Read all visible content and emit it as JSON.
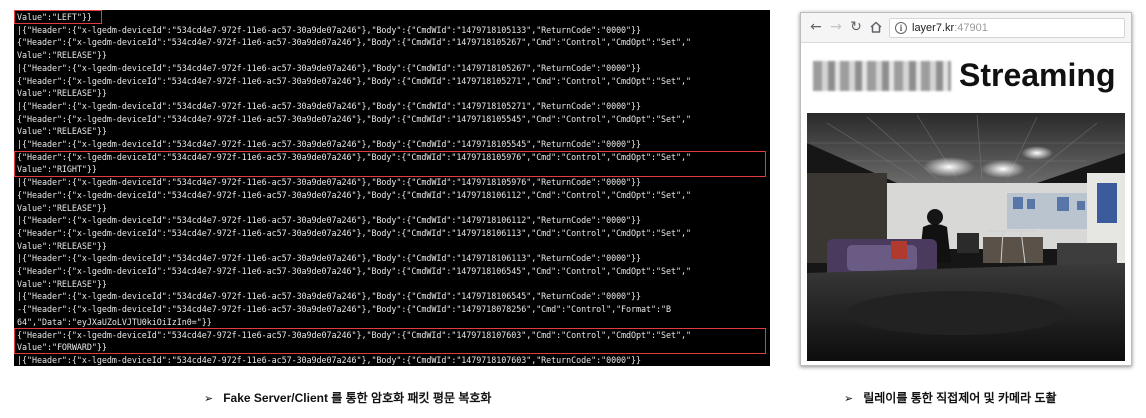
{
  "terminal": {
    "lines": [
      "Value\":\"LEFT\"}}",
      "|{\"Header\":{\"x-lgedm-deviceId\":\"534cd4e7-972f-11e6-ac57-30a9de07a246\"},\"Body\":{\"CmdWId\":\"1479718105133\",\"ReturnCode\":\"0000\"}}",
      "{\"Header\":{\"x-lgedm-deviceId\":\"534cd4e7-972f-11e6-ac57-30a9de07a246\"},\"Body\":{\"CmdWId\":\"1479718105267\",\"Cmd\":\"Control\",\"CmdOpt\":\"Set\",\"",
      "Value\":\"RELEASE\"}}",
      "|{\"Header\":{\"x-lgedm-deviceId\":\"534cd4e7-972f-11e6-ac57-30a9de07a246\"},\"Body\":{\"CmdWId\":\"1479718105267\",\"ReturnCode\":\"0000\"}}",
      "{\"Header\":{\"x-lgedm-deviceId\":\"534cd4e7-972f-11e6-ac57-30a9de07a246\"},\"Body\":{\"CmdWId\":\"1479718105271\",\"Cmd\":\"Control\",\"CmdOpt\":\"Set\",\"",
      "Value\":\"RELEASE\"}}",
      "|{\"Header\":{\"x-lgedm-deviceId\":\"534cd4e7-972f-11e6-ac57-30a9de07a246\"},\"Body\":{\"CmdWId\":\"1479718105271\",\"ReturnCode\":\"0000\"}}",
      "{\"Header\":{\"x-lgedm-deviceId\":\"534cd4e7-972f-11e6-ac57-30a9de07a246\"},\"Body\":{\"CmdWId\":\"1479718105545\",\"Cmd\":\"Control\",\"CmdOpt\":\"Set\",\"",
      "Value\":\"RELEASE\"}}",
      "|{\"Header\":{\"x-lgedm-deviceId\":\"534cd4e7-972f-11e6-ac57-30a9de07a246\"},\"Body\":{\"CmdWId\":\"1479718105545\",\"ReturnCode\":\"0000\"}}",
      "{\"Header\":{\"x-lgedm-deviceId\":\"534cd4e7-972f-11e6-ac57-30a9de07a246\"},\"Body\":{\"CmdWId\":\"1479718105976\",\"Cmd\":\"Control\",\"CmdOpt\":\"Set\",\"",
      "Value\":\"RIGHT\"}}",
      "|{\"Header\":{\"x-lgedm-deviceId\":\"534cd4e7-972f-11e6-ac57-30a9de07a246\"},\"Body\":{\"CmdWId\":\"1479718105976\",\"ReturnCode\":\"0000\"}}",
      "{\"Header\":{\"x-lgedm-deviceId\":\"534cd4e7-972f-11e6-ac57-30a9de07a246\"},\"Body\":{\"CmdWId\":\"1479718106112\",\"Cmd\":\"Control\",\"CmdOpt\":\"Set\",\"",
      "Value\":\"RELEASE\"}}",
      "|{\"Header\":{\"x-lgedm-deviceId\":\"534cd4e7-972f-11e6-ac57-30a9de07a246\"},\"Body\":{\"CmdWId\":\"1479718106112\",\"ReturnCode\":\"0000\"}}",
      "{\"Header\":{\"x-lgedm-deviceId\":\"534cd4e7-972f-11e6-ac57-30a9de07a246\"},\"Body\":{\"CmdWId\":\"1479718106113\",\"Cmd\":\"Control\",\"CmdOpt\":\"Set\",\"",
      "Value\":\"RELEASE\"}}",
      "|{\"Header\":{\"x-lgedm-deviceId\":\"534cd4e7-972f-11e6-ac57-30a9de07a246\"},\"Body\":{\"CmdWId\":\"1479718106113\",\"ReturnCode\":\"0000\"}}",
      "{\"Header\":{\"x-lgedm-deviceId\":\"534cd4e7-972f-11e6-ac57-30a9de07a246\"},\"Body\":{\"CmdWId\":\"1479718106545\",\"Cmd\":\"Control\",\"CmdOpt\":\"Set\",\"",
      "Value\":\"RELEASE\"}}",
      "|{\"Header\":{\"x-lgedm-deviceId\":\"534cd4e7-972f-11e6-ac57-30a9de07a246\"},\"Body\":{\"CmdWId\":\"1479718106545\",\"ReturnCode\":\"0000\"}}",
      "-{\"Header\":{\"x-lgedm-deviceId\":\"534cd4e7-972f-11e6-ac57-30a9de07a246\"},\"Body\":{\"CmdWId\":\"1479718078256\",\"Cmd\":\"Control\",\"Format\":\"B",
      "64\",\"Data\":\"eyJXaUZoLVJTU0kiOiIzIn0=\"}}",
      "{\"Header\":{\"x-lgedm-deviceId\":\"534cd4e7-972f-11e6-ac57-30a9de07a246\"},\"Body\":{\"CmdWId\":\"1479718107603\",\"Cmd\":\"Control\",\"CmdOpt\":\"Set\",\"",
      "Value\":\"FORWARD\"}}",
      "|{\"Header\":{\"x-lgedm-deviceId\":\"534cd4e7-972f-11e6-ac57-30a9de07a246\"},\"Body\":{\"CmdWId\":\"1479718107603\",\"ReturnCode\":\"0000\"}}"
    ],
    "highlight_color": "#e23b3b"
  },
  "browser": {
    "back_icon": "back-arrow-icon",
    "forward_icon": "forward-arrow-icon",
    "reload_icon": "reload-icon",
    "home_icon": "home-icon",
    "info_icon": "info-icon",
    "url_host": "layer7.kr",
    "url_port": ":47901",
    "page_heading": "Streaming"
  },
  "captions": {
    "left": {
      "arrow": "➢",
      "bold": "Fake Server/Client",
      "rest": " 를 통한 암호화 패킷 평문 복호화"
    },
    "right": {
      "arrow": "➢",
      "text": "릴레이를 통한 직접제어 및 카메라 도촬"
    }
  }
}
